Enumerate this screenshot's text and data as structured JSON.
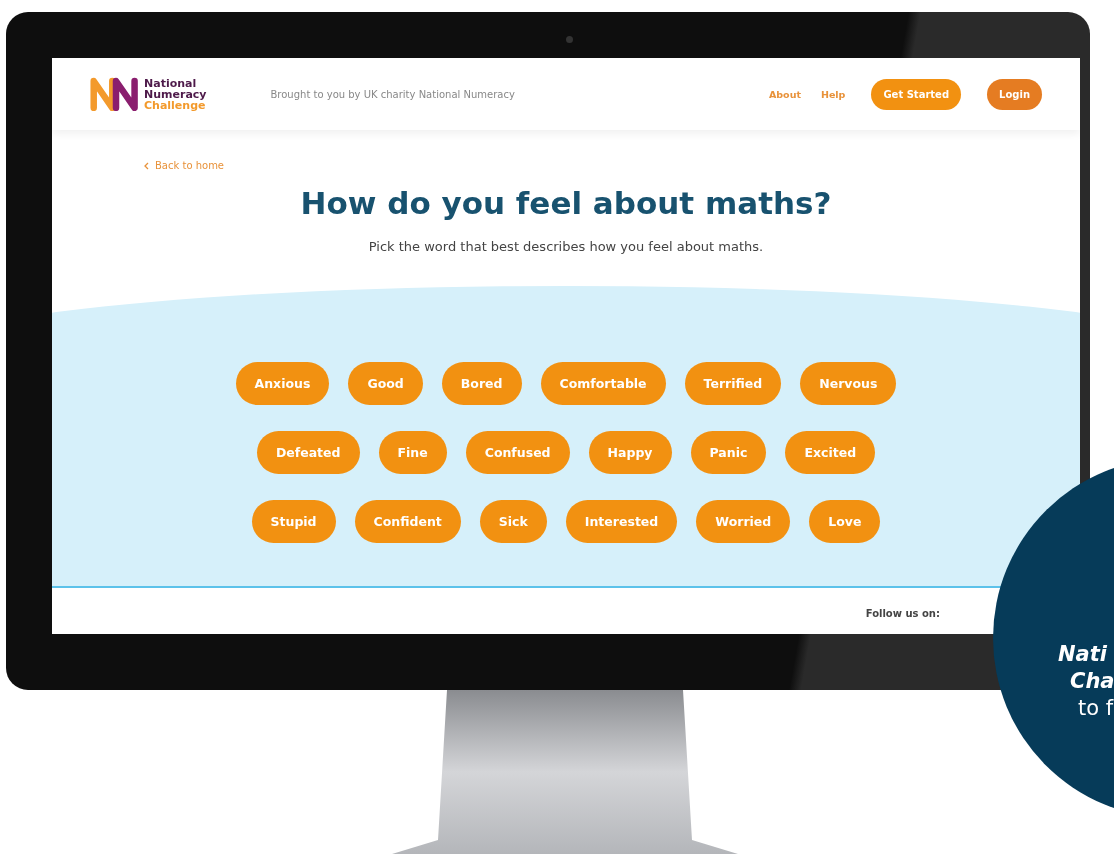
{
  "header": {
    "logo": {
      "line1": "National",
      "line2": "Numeracy",
      "line3": "Challenge"
    },
    "tagline": "Brought to you by UK charity National Numeracy",
    "nav": [
      {
        "label": "About",
        "kind": "link"
      },
      {
        "label": "Help",
        "kind": "link"
      },
      {
        "label": "Get Started",
        "kind": "button",
        "color": "#f29111"
      },
      {
        "label": "Login",
        "kind": "button",
        "color": "#e57c22"
      }
    ]
  },
  "back_link": "Back to home",
  "title": "How do you feel about maths?",
  "subtitle": "Pick the word that best describes how you feel about maths.",
  "word_rows": [
    [
      "Anxious",
      "Good",
      "Bored",
      "Comfortable",
      "Terrified",
      "Nervous"
    ],
    [
      "Defeated",
      "Fine",
      "Confused",
      "Happy",
      "Panic",
      "Excited"
    ],
    [
      "Stupid",
      "Confident",
      "Sick",
      "Interested",
      "Worried",
      "Love"
    ]
  ],
  "footer": {
    "follow_label": "Follow us on:"
  },
  "promo": {
    "lines": [
      {
        "text": "Nati",
        "bold": true
      },
      {
        "text": "Cha",
        "bold": true
      },
      {
        "text": "to f",
        "bold": false
      }
    ]
  }
}
